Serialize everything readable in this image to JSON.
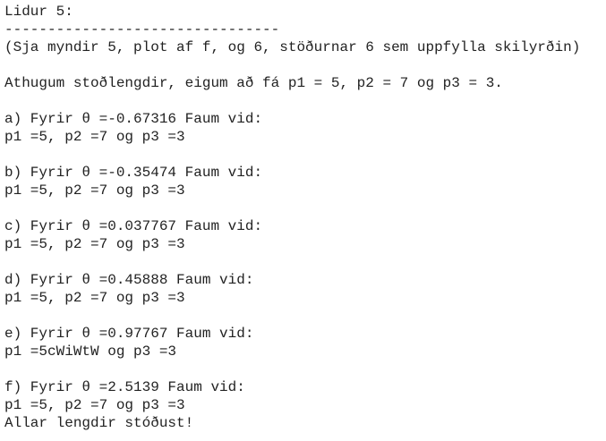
{
  "console": {
    "title": "Lidur 5:",
    "separator": "--------------------------------",
    "note": "(Sja myndir 5, plot af f, og 6, stöðurnar 6 sem uppfylla skilyrðin)",
    "intro": "Athugum stoðlengdir, eigum að fá p1 = 5, p2 = 7 og p3 = 3.",
    "results": [
      {
        "heading": "a) Fyrir θ =-0.67316 Faum vid:",
        "values": "p1 =5, p2 =7 og p3 =3"
      },
      {
        "heading": "b) Fyrir θ =-0.35474 Faum vid:",
        "values": "p1 =5, p2 =7 og p3 =3"
      },
      {
        "heading": "c) Fyrir θ =0.037767 Faum vid:",
        "values": "p1 =5, p2 =7 og p3 =3"
      },
      {
        "heading": "d) Fyrir θ =0.45888 Faum vid:",
        "values": "p1 =5, p2 =7 og p3 =3"
      },
      {
        "heading": "e) Fyrir θ =0.97767 Faum vid:",
        "values": "p1 =5cWiWtW og p3 =3"
      },
      {
        "heading": "f) Fyrir θ =2.5139 Faum vid:",
        "values": "p1 =5, p2 =7 og p3 =3"
      }
    ],
    "conclusion": "Allar lengdir stóðust!"
  }
}
